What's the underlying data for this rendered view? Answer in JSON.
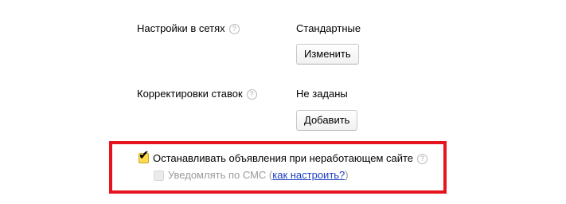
{
  "network_settings": {
    "label": "Настройки в сетях",
    "help": "?",
    "value": "Стандартные",
    "button": "Изменить"
  },
  "bid_adjustments": {
    "label": "Корректировки ставок",
    "help": "?",
    "value": "Не заданы",
    "button": "Добавить"
  },
  "stop_ads": {
    "checked": true,
    "label": "Останавливать объявления при неработающем сайте",
    "help": "?"
  },
  "sms_notify": {
    "checked": false,
    "disabled": true,
    "label_prefix": "Уведомлять по СМС (",
    "link_text": "как настроить?",
    "label_suffix": ")"
  },
  "colors": {
    "highlight_border": "#e5141f",
    "checkbox_checked": "#ffdb4d",
    "link": "#1a3dc1"
  }
}
